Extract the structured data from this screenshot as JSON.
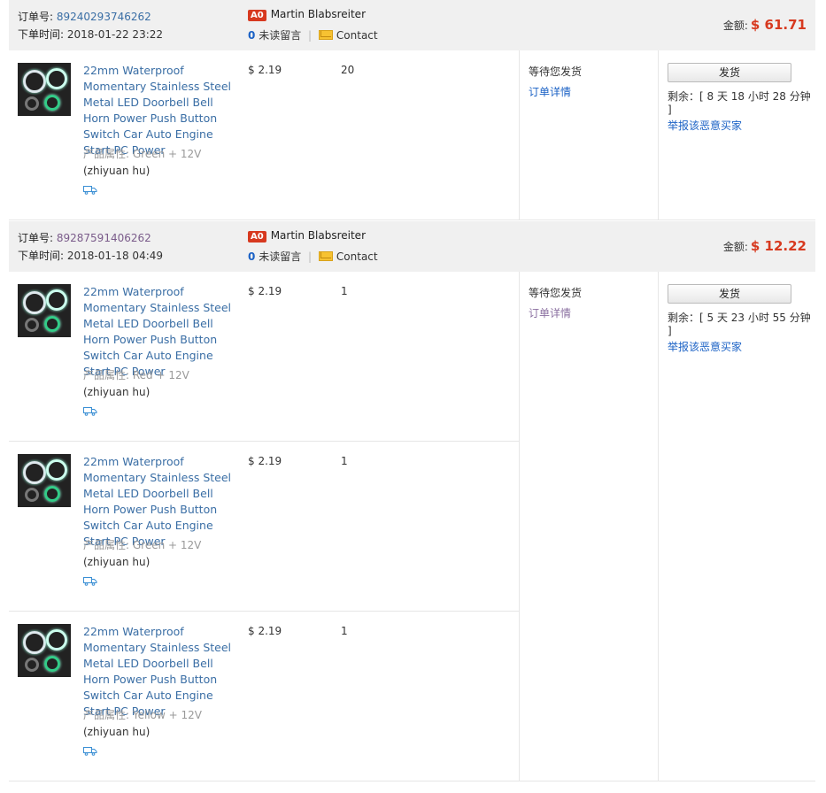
{
  "labels": {
    "order_no": "订单号:",
    "order_time": "下单时间:",
    "unread": "未读留言",
    "contact": "Contact",
    "amount": "金额:",
    "ship_button": "发货",
    "remaining": "剩余：",
    "report": "举报该恶意买家",
    "status": "等待您发货",
    "order_detail": "订单详情",
    "attr_label": "产品属性:"
  },
  "orders": [
    {
      "order_id": "89240293746262",
      "order_time": "2018-01-22 23:22",
      "buyer_badge": "A0",
      "buyer_name": "Martin Blabsreiter",
      "unread_count": "0",
      "amount": "$ 61.71",
      "countdown": "[ 8 天 18 小时 28 分钟 ]",
      "items": [
        {
          "title": "22mm Waterproof Momentary Stainless Steel Metal LED Doorbell Bell Horn Power Push Button Switch Car Auto Engine Start PC Power",
          "attribute": "Green + 12V",
          "supplier": "(zhiyuan hu)",
          "price": "$ 2.19",
          "qty": "20"
        }
      ]
    },
    {
      "order_id": "89287591406262",
      "order_time": "2018-01-18 04:49",
      "buyer_badge": "A0",
      "buyer_name": "Martin Blabsreiter",
      "unread_count": "0",
      "amount": "$ 12.22",
      "countdown": "[ 5 天 23 小时 55 分钟 ]",
      "items": [
        {
          "title": "22mm Waterproof Momentary Stainless Steel Metal LED Doorbell Bell Horn Power Push Button Switch Car Auto Engine Start PC Power",
          "attribute": "Red + 12V",
          "supplier": "(zhiyuan hu)",
          "price": "$ 2.19",
          "qty": "1"
        },
        {
          "title": "22mm Waterproof Momentary Stainless Steel Metal LED Doorbell Bell Horn Power Push Button Switch Car Auto Engine Start PC Power",
          "attribute": "Green + 12V",
          "supplier": "(zhiyuan hu)",
          "price": "$ 2.19",
          "qty": "1"
        },
        {
          "title": "22mm Waterproof Momentary Stainless Steel Metal LED Doorbell Bell Horn Power Push Button Switch Car Auto Engine Start PC Power",
          "attribute": "Yellow + 12V",
          "supplier": "(zhiyuan hu)",
          "price": "$ 2.19",
          "qty": "1"
        }
      ]
    }
  ],
  "icons": {
    "mail": "mail-icon",
    "truck": "truck-icon",
    "badge": "buyer-level-badge"
  },
  "colors": {
    "link": "#3a6ea5",
    "amount": "#d7391f",
    "header_bg": "#f0f0f0"
  }
}
